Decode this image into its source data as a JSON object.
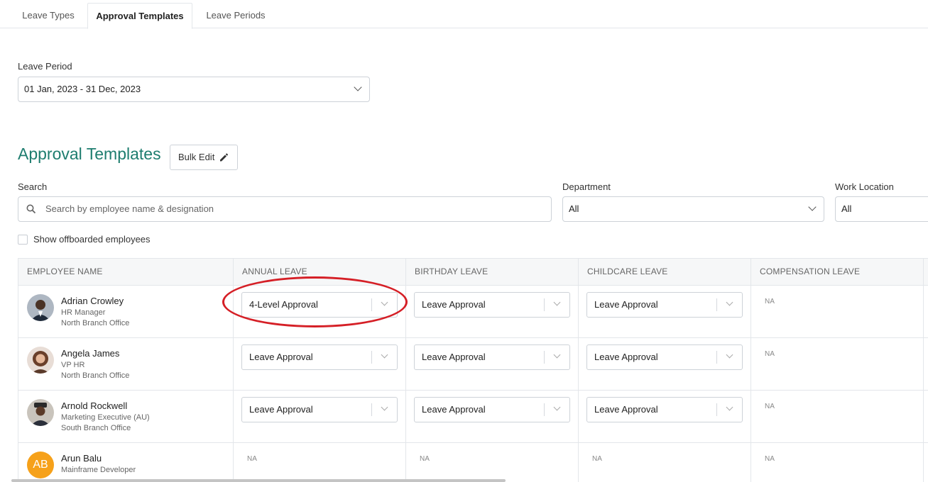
{
  "tabs": [
    {
      "label": "Leave Types",
      "active": false
    },
    {
      "label": "Approval Templates",
      "active": true
    },
    {
      "label": "Leave Periods",
      "active": false
    }
  ],
  "leave_period": {
    "label": "Leave Period",
    "value": "01 Jan, 2023 - 31 Dec, 2023"
  },
  "section": {
    "title": "Approval Templates",
    "bulk_edit_label": "Bulk Edit"
  },
  "filters": {
    "search_label": "Search",
    "search_placeholder": "Search by employee name & designation",
    "department_label": "Department",
    "department_value": "All",
    "work_location_label": "Work Location",
    "work_location_value": "All",
    "show_offboarded_label": "Show offboarded employees",
    "show_offboarded_checked": false
  },
  "table": {
    "columns": [
      "EMPLOYEE NAME",
      "ANNUAL LEAVE",
      "BIRTHDAY LEAVE",
      "CHILDCARE LEAVE",
      "COMPENSATION LEAVE"
    ],
    "rows": [
      {
        "name": "Adrian Crowley",
        "designation": "HR Manager",
        "location": "North Branch Office",
        "annual": "4-Level Approval",
        "birthday": "Leave Approval",
        "childcare": "Leave Approval",
        "compensation": "NA"
      },
      {
        "name": "Angela James",
        "designation": "VP HR",
        "location": "North Branch Office",
        "annual": "Leave Approval",
        "birthday": "Leave Approval",
        "childcare": "Leave Approval",
        "compensation": "NA"
      },
      {
        "name": "Arnold Rockwell",
        "designation": "Marketing Executive (AU)",
        "location": "South Branch Office",
        "annual": "Leave Approval",
        "birthday": "Leave Approval",
        "childcare": "Leave Approval",
        "compensation": "NA"
      },
      {
        "name": "Arun Balu",
        "initials": "AB",
        "designation": "Mainframe Developer",
        "location": "",
        "annual": "NA",
        "birthday": "NA",
        "childcare": "NA",
        "compensation": "NA"
      }
    ]
  },
  "colors": {
    "accent_teal": "#1e7d6f",
    "annotation_red": "#d51f26",
    "avatar_orange": "#f6a11a"
  }
}
